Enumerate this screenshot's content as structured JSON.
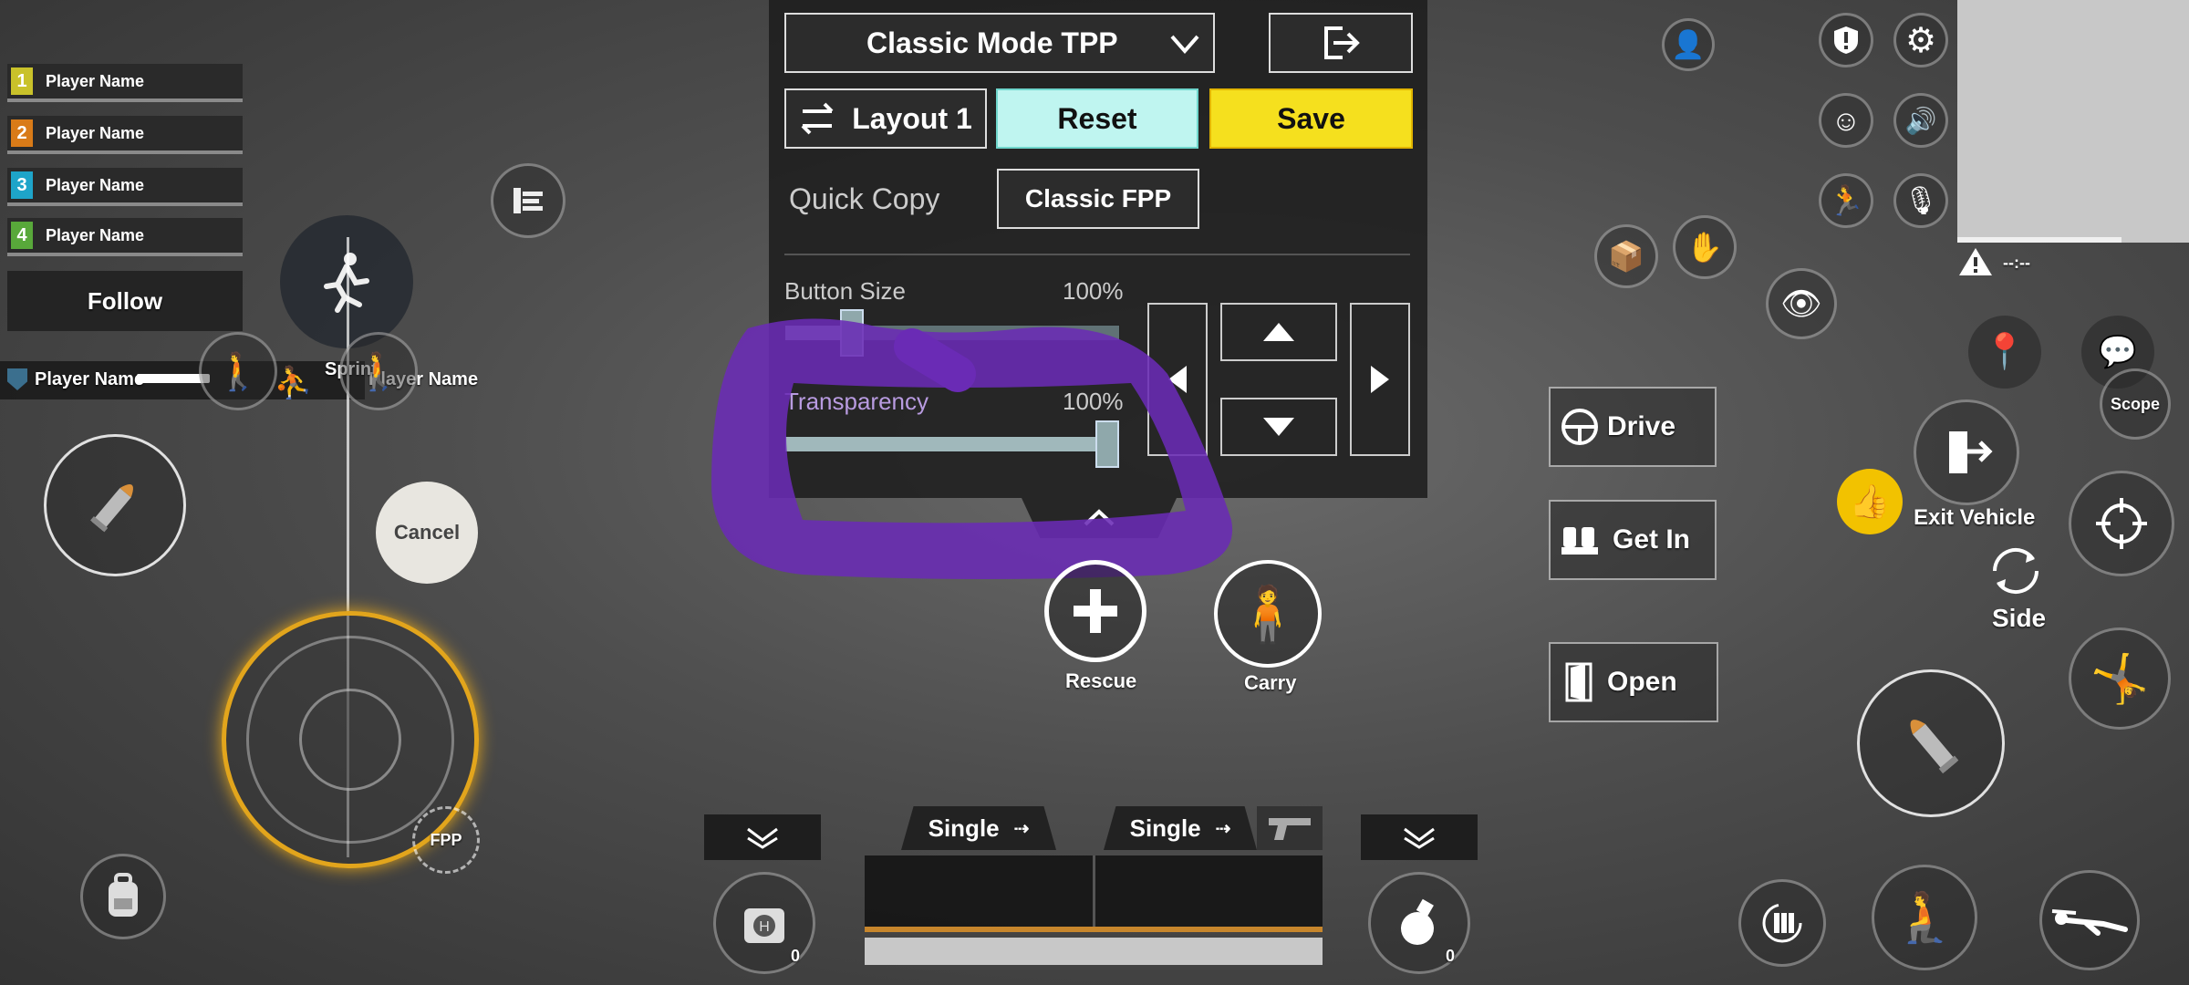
{
  "team": [
    {
      "num": "1",
      "name": "Player Name",
      "color": "#c9c22a"
    },
    {
      "num": "2",
      "name": "Player Name",
      "color": "#d97b18"
    },
    {
      "num": "3",
      "name": "Player Name",
      "color": "#1ea4c9"
    },
    {
      "num": "4",
      "name": "Player Name",
      "color": "#58a83a"
    }
  ],
  "follow_label": "Follow",
  "kill_feed": {
    "left_name": "Player Name",
    "right_name": "Player Name"
  },
  "sprint_label": "Sprint",
  "cancel_label": "Cancel",
  "fpp_label": "FPP",
  "panel": {
    "mode_select": "Classic Mode TPP",
    "layout_label": "Layout 1",
    "reset_label": "Reset",
    "save_label": "Save",
    "quick_copy_label": "Quick Copy",
    "quick_copy_value": "Classic FPP",
    "button_size_label": "Button Size",
    "button_size_value": "100%",
    "button_size_fraction": 0.2,
    "transparency_label": "Transparency",
    "transparency_value": "100%",
    "transparency_fraction": 1.0
  },
  "actions": {
    "rescue": "Rescue",
    "carry": "Carry"
  },
  "vehicle": {
    "drive": "Drive",
    "get_in": "Get In",
    "open": "Open",
    "exit_vehicle": "Exit Vehicle"
  },
  "right": {
    "scope": "Scope",
    "side": "Side",
    "minimap_status": "--:--"
  },
  "weapons": {
    "slot1_mode": "Single",
    "slot2_mode": "Single"
  },
  "items": {
    "heal_count": "0",
    "grenade_count": "0"
  },
  "colors": {
    "accent_yellow": "#f2c200",
    "reset_cyan": "#bff5f0",
    "save_yellow": "#f5e01e",
    "scribble": "#6a2bb5"
  }
}
